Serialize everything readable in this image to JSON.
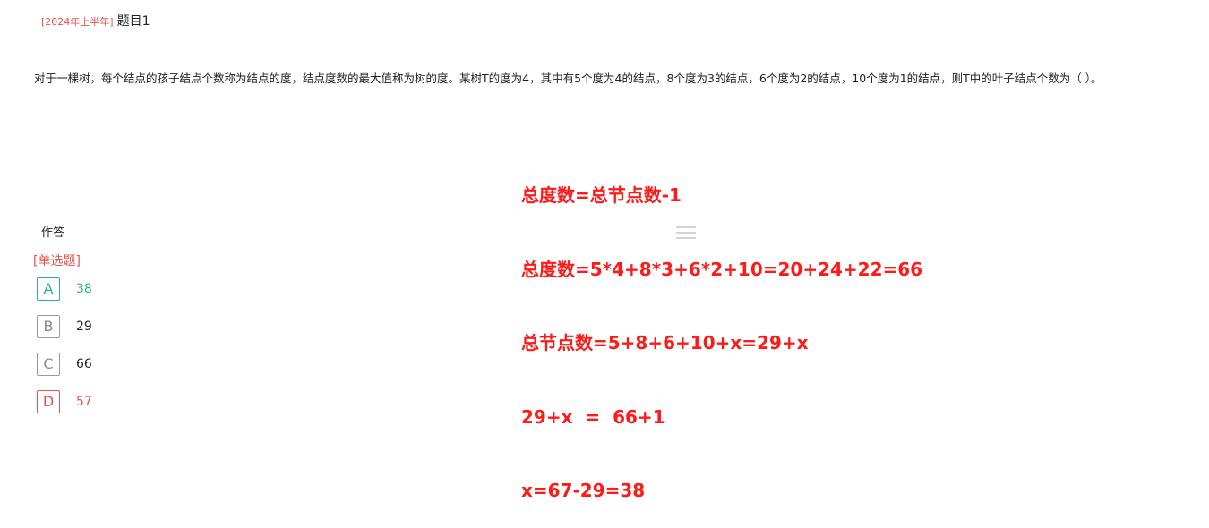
{
  "question": {
    "exam_tag": "[2024年上半年]",
    "title": "题目1",
    "stem": "对于一棵树，每个结点的孩子结点个数称为结点的度，结点度数的最大值称为树的度。某树T的度为4，其中有5个度为4的结点，8个度为3的结点，6个度为2的结点，10个度为1的结点，则T中的叶子结点个数为（ ）。"
  },
  "annotation": {
    "lines": [
      "总度数=总节点数-1",
      "总度数=5*4+8*3+6*2+10=20+24+22=66",
      "总节点数=5+8+6+10+x=29+x",
      "29+x  =  66+1",
      "x=67-29=38"
    ],
    "color": "#ff1a1a"
  },
  "answer": {
    "header": "作答",
    "type_label": "[单选题]",
    "options": [
      {
        "letter": "A",
        "value": "38",
        "state": "correct"
      },
      {
        "letter": "B",
        "value": "29",
        "state": "normal"
      },
      {
        "letter": "C",
        "value": "66",
        "state": "normal"
      },
      {
        "letter": "D",
        "value": "57",
        "state": "wrong"
      }
    ]
  },
  "colors": {
    "accent_red": "#e8554e",
    "correct_green": "#2bb38a",
    "annotation_red": "#ff1a1a"
  },
  "icons": {
    "drag_handle": "drag-handle-icon"
  }
}
